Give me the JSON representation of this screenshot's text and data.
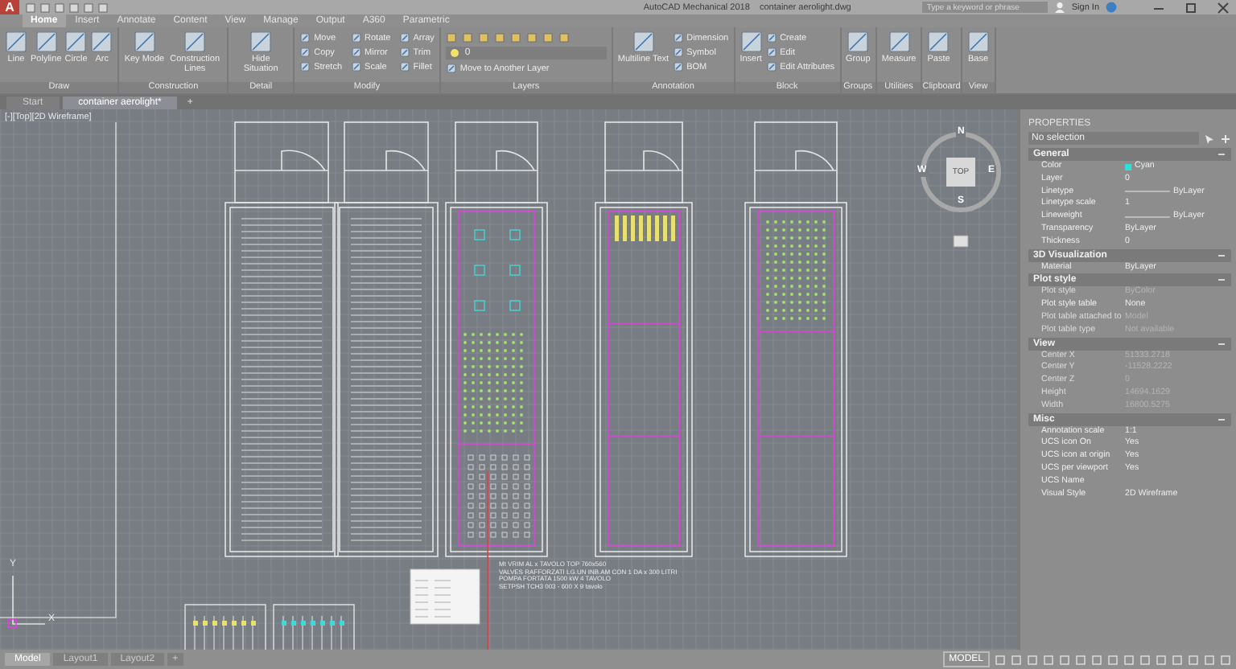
{
  "title_bar": {
    "app_letter": "A",
    "title": "AutoCAD Mechanical 2018    container aerolight.dwg",
    "search": {
      "placeholder": "Type a keyword or phrase"
    },
    "sign_in": "Sign In"
  },
  "ribbon_tabs": [
    {
      "label": "Home",
      "selected": true
    },
    {
      "label": "Insert",
      "selected": false
    },
    {
      "label": "Annotate",
      "selected": false
    },
    {
      "label": "Content",
      "selected": false
    },
    {
      "label": "View",
      "selected": false
    },
    {
      "label": "Manage",
      "selected": false
    },
    {
      "label": "Output",
      "selected": false
    },
    {
      "label": "A360",
      "selected": false
    },
    {
      "label": "Parametric",
      "selected": false
    }
  ],
  "ribbon_groups": [
    {
      "title": "Draw",
      "items": [
        {
          "kind": "large",
          "label": "Line"
        },
        {
          "kind": "large",
          "label": "Polyline"
        },
        {
          "kind": "large",
          "label": "Circle"
        },
        {
          "kind": "large",
          "label": "Arc"
        }
      ]
    },
    {
      "title": "Construction",
      "items": [
        {
          "kind": "large",
          "label": "Key Mode"
        },
        {
          "kind": "large",
          "label": "Construction Lines"
        }
      ]
    },
    {
      "title": "Detail",
      "items": [
        {
          "kind": "large",
          "label": "Hide Situation"
        }
      ]
    },
    {
      "title": "Modify",
      "items": [
        {
          "kind": "small",
          "label": "Move"
        },
        {
          "kind": "small",
          "label": "Copy"
        },
        {
          "kind": "small",
          "label": "Stretch"
        },
        {
          "kind": "small",
          "label": "Rotate"
        },
        {
          "kind": "small",
          "label": "Mirror"
        },
        {
          "kind": "small",
          "label": "Scale"
        },
        {
          "kind": "small",
          "label": "Array"
        },
        {
          "kind": "small",
          "label": "Trim"
        },
        {
          "kind": "small",
          "label": "Fillet"
        }
      ]
    },
    {
      "title": "Layers",
      "items": [
        {
          "kind": "combo",
          "label": "0"
        },
        {
          "kind": "small",
          "label": "Move to Another Layer"
        }
      ]
    },
    {
      "title": "Annotation",
      "items": [
        {
          "kind": "large",
          "label": "Multiline Text"
        },
        {
          "kind": "small",
          "label": "Dimension"
        },
        {
          "kind": "small",
          "label": "Symbol"
        },
        {
          "kind": "small",
          "label": "BOM"
        }
      ]
    },
    {
      "title": "Block",
      "items": [
        {
          "kind": "large",
          "label": "Insert"
        },
        {
          "kind": "small",
          "label": "Create"
        },
        {
          "kind": "small",
          "label": "Edit"
        },
        {
          "kind": "small",
          "label": "Edit Attributes"
        }
      ]
    },
    {
      "title": "Groups",
      "items": [
        {
          "kind": "large",
          "label": "Group"
        }
      ]
    },
    {
      "title": "Utilities",
      "items": [
        {
          "kind": "large",
          "label": "Measure"
        }
      ]
    },
    {
      "title": "Clipboard",
      "items": [
        {
          "kind": "large",
          "label": "Paste"
        }
      ]
    },
    {
      "title": "View",
      "items": [
        {
          "kind": "large",
          "label": "Base"
        }
      ]
    }
  ],
  "file_tabs": [
    {
      "label": "Start",
      "selected": false
    },
    {
      "label": "container aerolight*",
      "selected": true
    }
  ],
  "add_file_tab": "+",
  "viewport_label": "[-][Top][2D Wireframe]",
  "view_cube": {
    "face": "TOP",
    "north": "N",
    "south": "S",
    "east": "E",
    "west": "W"
  },
  "ucs_icon": {
    "x_label": "X",
    "y_label": "Y"
  },
  "drawing_notes": [
    "Mt VRIM AL x TAVOLO TOP 760x560",
    "VALVES RAFFORZATI LG.UN INB.AM CON 1 DA x 300 LITRI",
    "POMPA FORTATA 1500 kW 4 TAVOLO",
    "SETPSH TCH3 003 - 600 X 9 tavolo"
  ],
  "properties": {
    "title": "PROPERTIES",
    "selection": "No selection",
    "sections": [
      {
        "title": "General",
        "expanded": true,
        "rows": [
          {
            "label": "Color",
            "value": "Cyan",
            "kind": "color",
            "color": "#2ee0d8",
            "disabled": false
          },
          {
            "label": "Layer",
            "value": "0",
            "kind": "text",
            "disabled": false
          },
          {
            "label": "Linetype",
            "value": "ByLayer",
            "kind": "line",
            "disabled": false
          },
          {
            "label": "Linetype scale",
            "value": "1",
            "kind": "text",
            "disabled": false
          },
          {
            "label": "Lineweight",
            "value": "ByLayer",
            "kind": "line",
            "disabled": false
          },
          {
            "label": "Transparency",
            "value": "ByLayer",
            "kind": "text",
            "disabled": false
          },
          {
            "label": "Thickness",
            "value": "0",
            "kind": "text",
            "disabled": false
          }
        ]
      },
      {
        "title": "3D Visualization",
        "expanded": true,
        "rows": [
          {
            "label": "Material",
            "value": "ByLayer",
            "kind": "text",
            "disabled": false
          }
        ]
      },
      {
        "title": "Plot style",
        "expanded": true,
        "rows": [
          {
            "label": "Plot style",
            "value": "ByColor",
            "kind": "text",
            "disabled": true
          },
          {
            "label": "Plot style table",
            "value": "None",
            "kind": "text",
            "disabled": false
          },
          {
            "label": "Plot table attached to",
            "value": "Model",
            "kind": "text",
            "disabled": true
          },
          {
            "label": "Plot table type",
            "value": "Not available",
            "kind": "text",
            "disabled": true
          }
        ]
      },
      {
        "title": "View",
        "expanded": true,
        "rows": [
          {
            "label": "Center X",
            "value": "51333.2718",
            "kind": "text",
            "disabled": true
          },
          {
            "label": "Center Y",
            "value": "-11528.2222",
            "kind": "text",
            "disabled": true
          },
          {
            "label": "Center Z",
            "value": "0",
            "kind": "text",
            "disabled": true
          },
          {
            "label": "Height",
            "value": "14694.1629",
            "kind": "text",
            "disabled": true
          },
          {
            "label": "Width",
            "value": "16800.5275",
            "kind": "text",
            "disabled": true
          }
        ]
      },
      {
        "title": "Misc",
        "expanded": true,
        "rows": [
          {
            "label": "Annotation scale",
            "value": "1:1",
            "kind": "text",
            "disabled": false
          },
          {
            "label": "UCS icon On",
            "value": "Yes",
            "kind": "text",
            "disabled": false
          },
          {
            "label": "UCS icon at origin",
            "value": "Yes",
            "kind": "text",
            "disabled": false
          },
          {
            "label": "UCS per viewport",
            "value": "Yes",
            "kind": "text",
            "disabled": false
          },
          {
            "label": "UCS Name",
            "kind": "text",
            "disabled": false
          },
          {
            "label": "Visual Style",
            "value": "2D Wireframe",
            "kind": "text",
            "disabled": false
          }
        ]
      }
    ]
  },
  "layout_tabs": [
    {
      "label": "Model",
      "selected": true
    },
    {
      "label": "Layout1",
      "selected": false
    },
    {
      "label": "Layout2",
      "selected": false
    }
  ],
  "add_layout_tab": "+",
  "status_bar": {
    "mode": "MODEL"
  }
}
